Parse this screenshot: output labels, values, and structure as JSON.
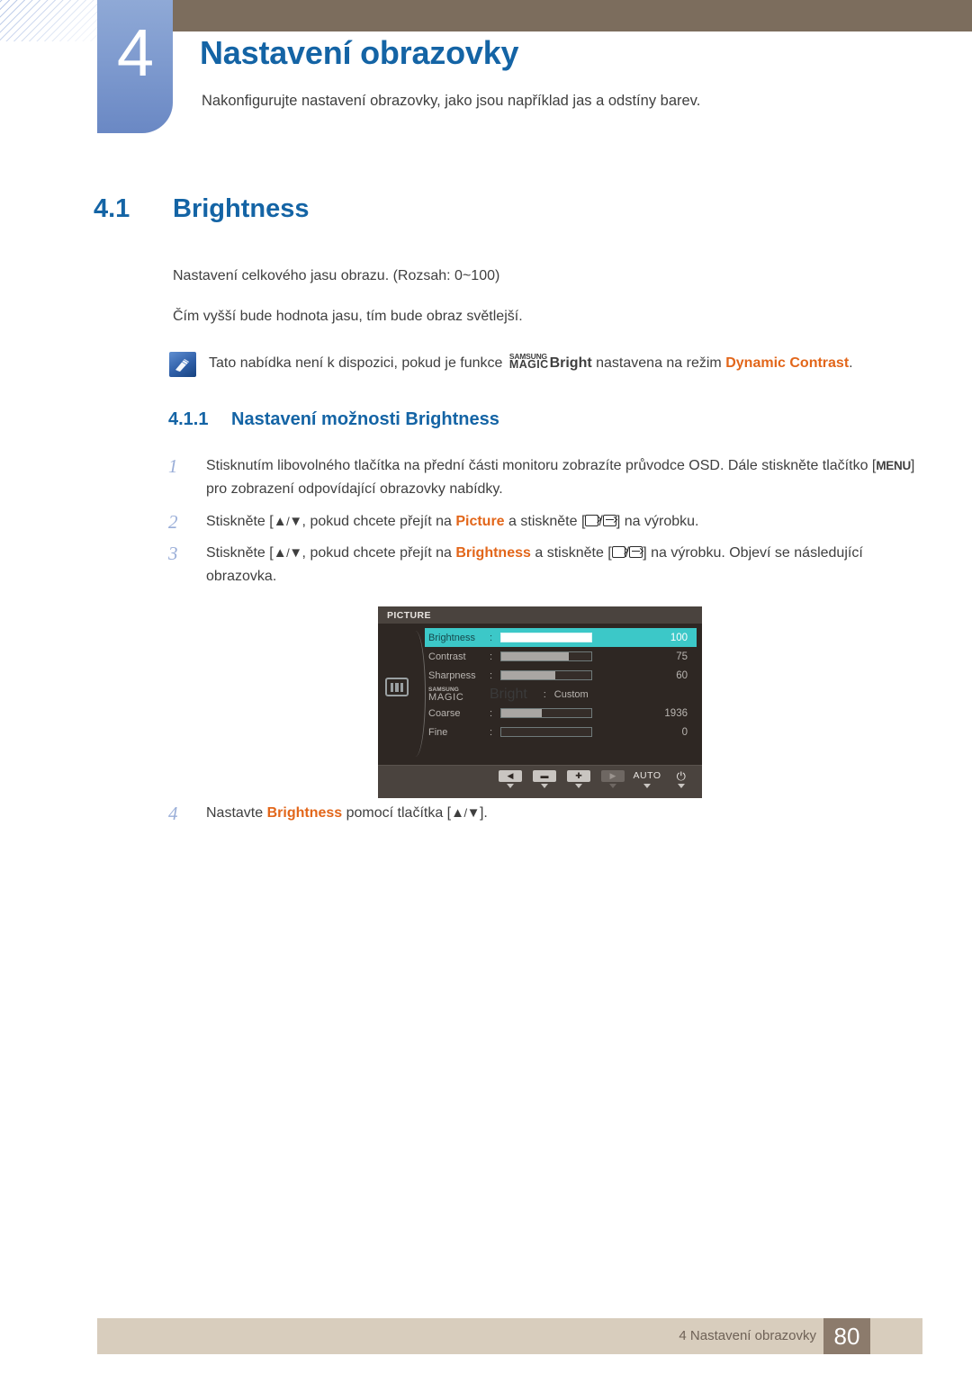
{
  "header": {
    "chapter_number": "4",
    "chapter_title": "Nastavení obrazovky",
    "chapter_subtitle": "Nakonfigurujte nastavení obrazovky, jako jsou například jas a odstíny barev."
  },
  "section": {
    "number": "4.1",
    "title": "Brightness",
    "paragraph_1": "Nastavení celkového jasu obrazu. (Rozsah: 0~100)",
    "paragraph_2": "Čím vyšší bude hodnota jasu, tím bude obraz světlejší."
  },
  "note": {
    "icon": "note-pencil-icon",
    "text_before": "Tato nabídka není k dispozici, pokud je funkce",
    "magic_top": "SAMSUNG",
    "magic_bottom": "MAGIC",
    "magic_suffix": "Bright",
    "text_middle": "nastavena na režim",
    "highlight": "Dynamic Contrast",
    "text_end": "."
  },
  "subsection": {
    "number": "4.1.1",
    "title": "Nastavení možnosti Brightness"
  },
  "steps": [
    {
      "number": "1",
      "part_1": "Stisknutím libovolného tlačítka na přední části monitoru zobrazíte průvodce OSD. Dále stiskněte tlačítko [",
      "key": "MENU",
      "part_2": "] pro zobrazení odpovídající obrazovky nabídky."
    },
    {
      "number": "2",
      "part_1": "Stiskněte [",
      "arrows": "▲/▼",
      "part_2": ", pokud chcete přejít na",
      "highlight": "Picture",
      "part_3": "a stiskněte [",
      "part_4": "] na výrobku."
    },
    {
      "number": "3",
      "part_1": "Stiskněte [",
      "arrows": "▲/▼",
      "part_2": ", pokud chcete přejít na",
      "highlight": "Brightness",
      "part_3": "a stiskněte [",
      "part_4": "] na výrobku. Objeví se následující obrazovka."
    },
    {
      "number": "4",
      "part_1": "Nastavte",
      "highlight": "Brightness",
      "part_2": "pomocí tlačítka [",
      "arrows": "▲/▼",
      "part_3": "]."
    }
  ],
  "osd": {
    "title": "PICTURE",
    "left_icon": "picture-bars-icon",
    "rows": [
      {
        "label": "Brightness",
        "colon": ":",
        "value": "100",
        "fill": 100,
        "selected": true,
        "type": "slider"
      },
      {
        "label": "Contrast",
        "colon": ":",
        "value": "75",
        "fill": 75,
        "selected": false,
        "type": "slider"
      },
      {
        "label": "Sharpness",
        "colon": ":",
        "value": "60",
        "fill": 60,
        "selected": false,
        "type": "slider"
      },
      {
        "label": "MAGIC Bright",
        "magic_top": "SAMSUNG",
        "magic_main": "MAGIC",
        "magic_suffix": "Bright",
        "colon": ":",
        "value": "Custom",
        "selected": false,
        "type": "text"
      },
      {
        "label": "Coarse",
        "colon": ":",
        "value": "1936",
        "fill": 45,
        "selected": false,
        "type": "slider"
      },
      {
        "label": "Fine",
        "colon": ":",
        "value": "0",
        "fill": 0,
        "selected": false,
        "type": "slider"
      }
    ],
    "buttons": [
      {
        "name": "left-arrow-button",
        "glyph": "◀",
        "dim": false
      },
      {
        "name": "minus-button",
        "glyph": "▬",
        "dim": false
      },
      {
        "name": "plus-button",
        "glyph": "✚",
        "dim": false
      },
      {
        "name": "right-arrow-button",
        "glyph": "▶",
        "dim": true
      },
      {
        "name": "auto-button",
        "glyph": "AUTO",
        "dim": false,
        "plain": true
      },
      {
        "name": "power-button",
        "glyph": "⏻",
        "dim": false,
        "plain": true,
        "power": true
      }
    ]
  },
  "footer": {
    "text": "4 Nastavení obrazovky",
    "page": "80"
  },
  "colors": {
    "heading_blue": "#1464a5",
    "accent_orange": "#e2661a",
    "header_brown": "#7c6d5d",
    "footer_beige": "#d8cdbd",
    "footer_page_brown": "#8c7b6c",
    "osd_background": "#2e2723",
    "osd_selected": "#3cc8c8"
  }
}
